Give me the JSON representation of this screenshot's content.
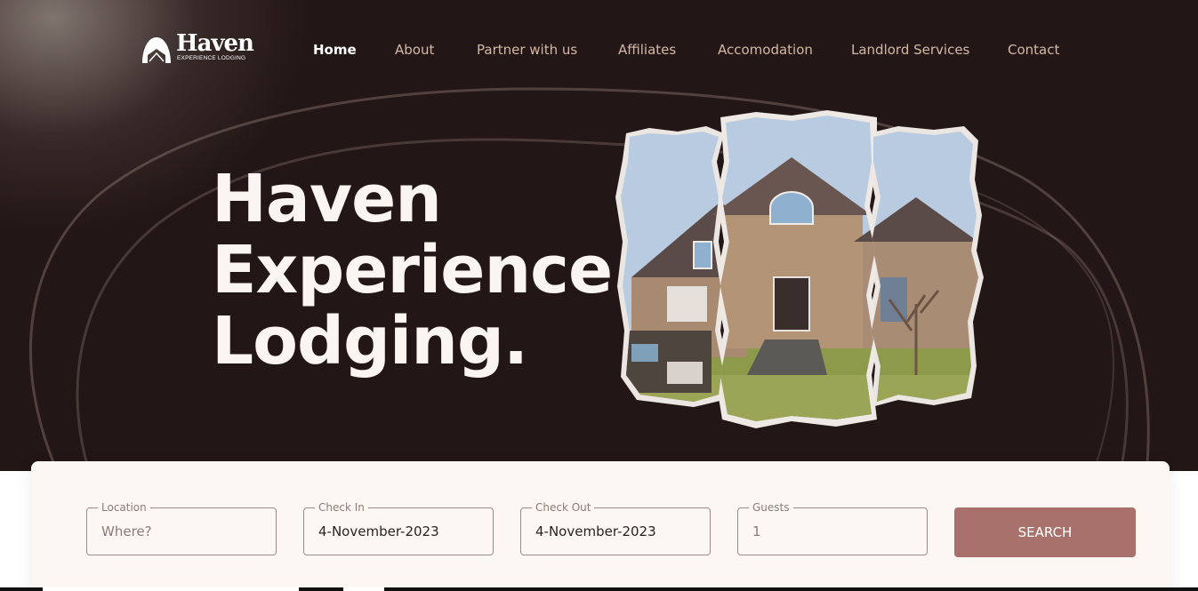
{
  "brand": {
    "name": "Haven",
    "tagline": "EXPERIENCE LODGING"
  },
  "nav": {
    "items": [
      {
        "label": "Home",
        "active": true
      },
      {
        "label": "About"
      },
      {
        "label": "Partner with us"
      },
      {
        "label": "Affiliates"
      },
      {
        "label": "Accomodation"
      },
      {
        "label": "Landlord Services"
      },
      {
        "label": "Contact"
      }
    ]
  },
  "hero": {
    "headline": [
      "Haven",
      "Experience",
      "Lodging."
    ],
    "image_alt": "house-collage-image"
  },
  "search": {
    "location": {
      "label": "Location",
      "placeholder": "Where?"
    },
    "check_in": {
      "label": "Check In",
      "value": "4-November-2023"
    },
    "check_out": {
      "label": "Check Out",
      "value": "4-November-2023"
    },
    "guests": {
      "label": "Guests",
      "value": "1"
    },
    "button_label": "SEARCH"
  },
  "colors": {
    "hero_background": "#231616",
    "nav_text": "#d4b8a6",
    "search_card": "#fcf7f3",
    "search_button": "#a8716b"
  }
}
